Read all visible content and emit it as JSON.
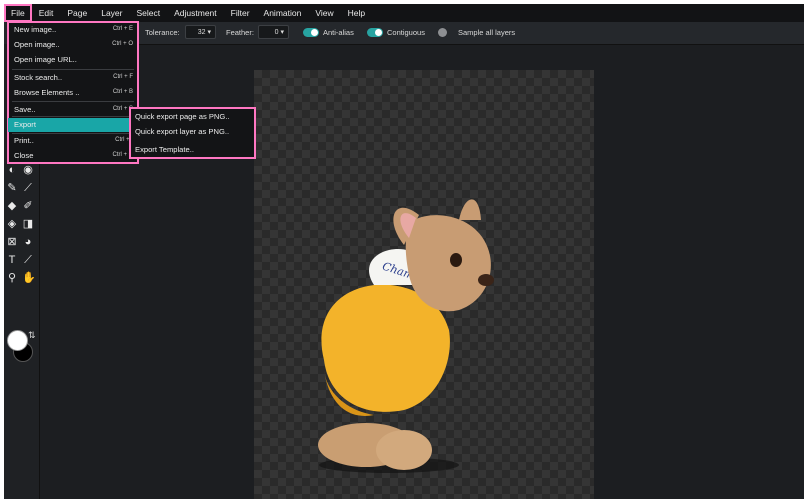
{
  "menubar": {
    "items": [
      "File",
      "Edit",
      "Page",
      "Layer",
      "Select",
      "Adjustment",
      "Filter",
      "Animation",
      "View",
      "Help"
    ]
  },
  "toolbar": {
    "tolerance_label": "Tolerance:",
    "tolerance_value": "32",
    "feather_label": "Feather:",
    "feather_value": "0",
    "antialias_label": "Anti-alias",
    "contiguous_label": "Contiguous",
    "sample_all_label": "Sample all layers",
    "antialias_on": true,
    "contiguous_on": true,
    "sample_all_on": false
  },
  "file_menu": {
    "items": [
      {
        "label": "New image..",
        "shortcut": "Ctrl + E"
      },
      {
        "label": "Open image..",
        "shortcut": "Ctrl + O"
      },
      {
        "label": "Open image URL..",
        "shortcut": ""
      },
      {
        "label": "Stock search..",
        "shortcut": "Ctrl + F"
      },
      {
        "label": "Browse Elements ..",
        "shortcut": "Ctrl + B"
      },
      {
        "label": "Save..",
        "shortcut": "Ctrl + S"
      },
      {
        "label": "Export",
        "shortcut": ""
      },
      {
        "label": "Print..",
        "shortcut": "Ctrl + I"
      },
      {
        "label": "Close",
        "shortcut": "Ctrl + C"
      }
    ]
  },
  "export_submenu": {
    "items": [
      "Quick export page as PNG..",
      "Quick export layer as PNG..",
      "Export Template.."
    ]
  },
  "tools": [
    "brightness-icon",
    "spot-heal-icon",
    "pencil-icon",
    "brush-icon",
    "eraser-icon",
    "color-replace-icon",
    "paint-bucket-icon",
    "gradient-icon",
    "crop-icon",
    "stamp-icon",
    "text-icon",
    "eyedropper-icon",
    "zoom-icon",
    "hand-icon"
  ],
  "colors": {
    "accent": "#19a6a7",
    "highlight_outline": "#ff77c2",
    "foreground": "#ffffff",
    "background": "#000000"
  },
  "canvas": {
    "image_subject": "french bulldog in yellow hoodie on transparent background",
    "hoodie_print": "Champion"
  }
}
